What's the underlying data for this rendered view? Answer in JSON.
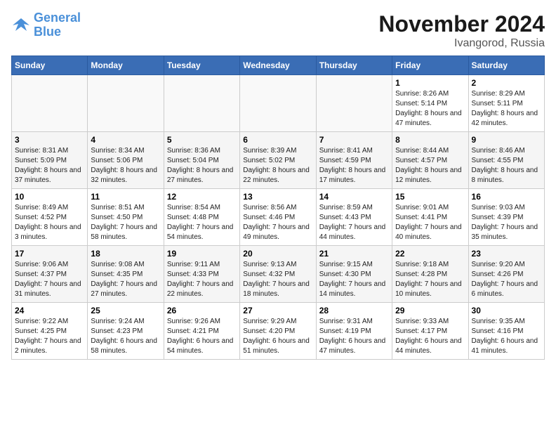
{
  "logo": {
    "line1": "General",
    "line2": "Blue"
  },
  "title": "November 2024",
  "location": "Ivangorod, Russia",
  "days_of_week": [
    "Sunday",
    "Monday",
    "Tuesday",
    "Wednesday",
    "Thursday",
    "Friday",
    "Saturday"
  ],
  "weeks": [
    [
      {
        "day": "",
        "info": ""
      },
      {
        "day": "",
        "info": ""
      },
      {
        "day": "",
        "info": ""
      },
      {
        "day": "",
        "info": ""
      },
      {
        "day": "",
        "info": ""
      },
      {
        "day": "1",
        "info": "Sunrise: 8:26 AM\nSunset: 5:14 PM\nDaylight: 8 hours and 47 minutes."
      },
      {
        "day": "2",
        "info": "Sunrise: 8:29 AM\nSunset: 5:11 PM\nDaylight: 8 hours and 42 minutes."
      }
    ],
    [
      {
        "day": "3",
        "info": "Sunrise: 8:31 AM\nSunset: 5:09 PM\nDaylight: 8 hours and 37 minutes."
      },
      {
        "day": "4",
        "info": "Sunrise: 8:34 AM\nSunset: 5:06 PM\nDaylight: 8 hours and 32 minutes."
      },
      {
        "day": "5",
        "info": "Sunrise: 8:36 AM\nSunset: 5:04 PM\nDaylight: 8 hours and 27 minutes."
      },
      {
        "day": "6",
        "info": "Sunrise: 8:39 AM\nSunset: 5:02 PM\nDaylight: 8 hours and 22 minutes."
      },
      {
        "day": "7",
        "info": "Sunrise: 8:41 AM\nSunset: 4:59 PM\nDaylight: 8 hours and 17 minutes."
      },
      {
        "day": "8",
        "info": "Sunrise: 8:44 AM\nSunset: 4:57 PM\nDaylight: 8 hours and 12 minutes."
      },
      {
        "day": "9",
        "info": "Sunrise: 8:46 AM\nSunset: 4:55 PM\nDaylight: 8 hours and 8 minutes."
      }
    ],
    [
      {
        "day": "10",
        "info": "Sunrise: 8:49 AM\nSunset: 4:52 PM\nDaylight: 8 hours and 3 minutes."
      },
      {
        "day": "11",
        "info": "Sunrise: 8:51 AM\nSunset: 4:50 PM\nDaylight: 7 hours and 58 minutes."
      },
      {
        "day": "12",
        "info": "Sunrise: 8:54 AM\nSunset: 4:48 PM\nDaylight: 7 hours and 54 minutes."
      },
      {
        "day": "13",
        "info": "Sunrise: 8:56 AM\nSunset: 4:46 PM\nDaylight: 7 hours and 49 minutes."
      },
      {
        "day": "14",
        "info": "Sunrise: 8:59 AM\nSunset: 4:43 PM\nDaylight: 7 hours and 44 minutes."
      },
      {
        "day": "15",
        "info": "Sunrise: 9:01 AM\nSunset: 4:41 PM\nDaylight: 7 hours and 40 minutes."
      },
      {
        "day": "16",
        "info": "Sunrise: 9:03 AM\nSunset: 4:39 PM\nDaylight: 7 hours and 35 minutes."
      }
    ],
    [
      {
        "day": "17",
        "info": "Sunrise: 9:06 AM\nSunset: 4:37 PM\nDaylight: 7 hours and 31 minutes."
      },
      {
        "day": "18",
        "info": "Sunrise: 9:08 AM\nSunset: 4:35 PM\nDaylight: 7 hours and 27 minutes."
      },
      {
        "day": "19",
        "info": "Sunrise: 9:11 AM\nSunset: 4:33 PM\nDaylight: 7 hours and 22 minutes."
      },
      {
        "day": "20",
        "info": "Sunrise: 9:13 AM\nSunset: 4:32 PM\nDaylight: 7 hours and 18 minutes."
      },
      {
        "day": "21",
        "info": "Sunrise: 9:15 AM\nSunset: 4:30 PM\nDaylight: 7 hours and 14 minutes."
      },
      {
        "day": "22",
        "info": "Sunrise: 9:18 AM\nSunset: 4:28 PM\nDaylight: 7 hours and 10 minutes."
      },
      {
        "day": "23",
        "info": "Sunrise: 9:20 AM\nSunset: 4:26 PM\nDaylight: 7 hours and 6 minutes."
      }
    ],
    [
      {
        "day": "24",
        "info": "Sunrise: 9:22 AM\nSunset: 4:25 PM\nDaylight: 7 hours and 2 minutes."
      },
      {
        "day": "25",
        "info": "Sunrise: 9:24 AM\nSunset: 4:23 PM\nDaylight: 6 hours and 58 minutes."
      },
      {
        "day": "26",
        "info": "Sunrise: 9:26 AM\nSunset: 4:21 PM\nDaylight: 6 hours and 54 minutes."
      },
      {
        "day": "27",
        "info": "Sunrise: 9:29 AM\nSunset: 4:20 PM\nDaylight: 6 hours and 51 minutes."
      },
      {
        "day": "28",
        "info": "Sunrise: 9:31 AM\nSunset: 4:19 PM\nDaylight: 6 hours and 47 minutes."
      },
      {
        "day": "29",
        "info": "Sunrise: 9:33 AM\nSunset: 4:17 PM\nDaylight: 6 hours and 44 minutes."
      },
      {
        "day": "30",
        "info": "Sunrise: 9:35 AM\nSunset: 4:16 PM\nDaylight: 6 hours and 41 minutes."
      }
    ]
  ]
}
